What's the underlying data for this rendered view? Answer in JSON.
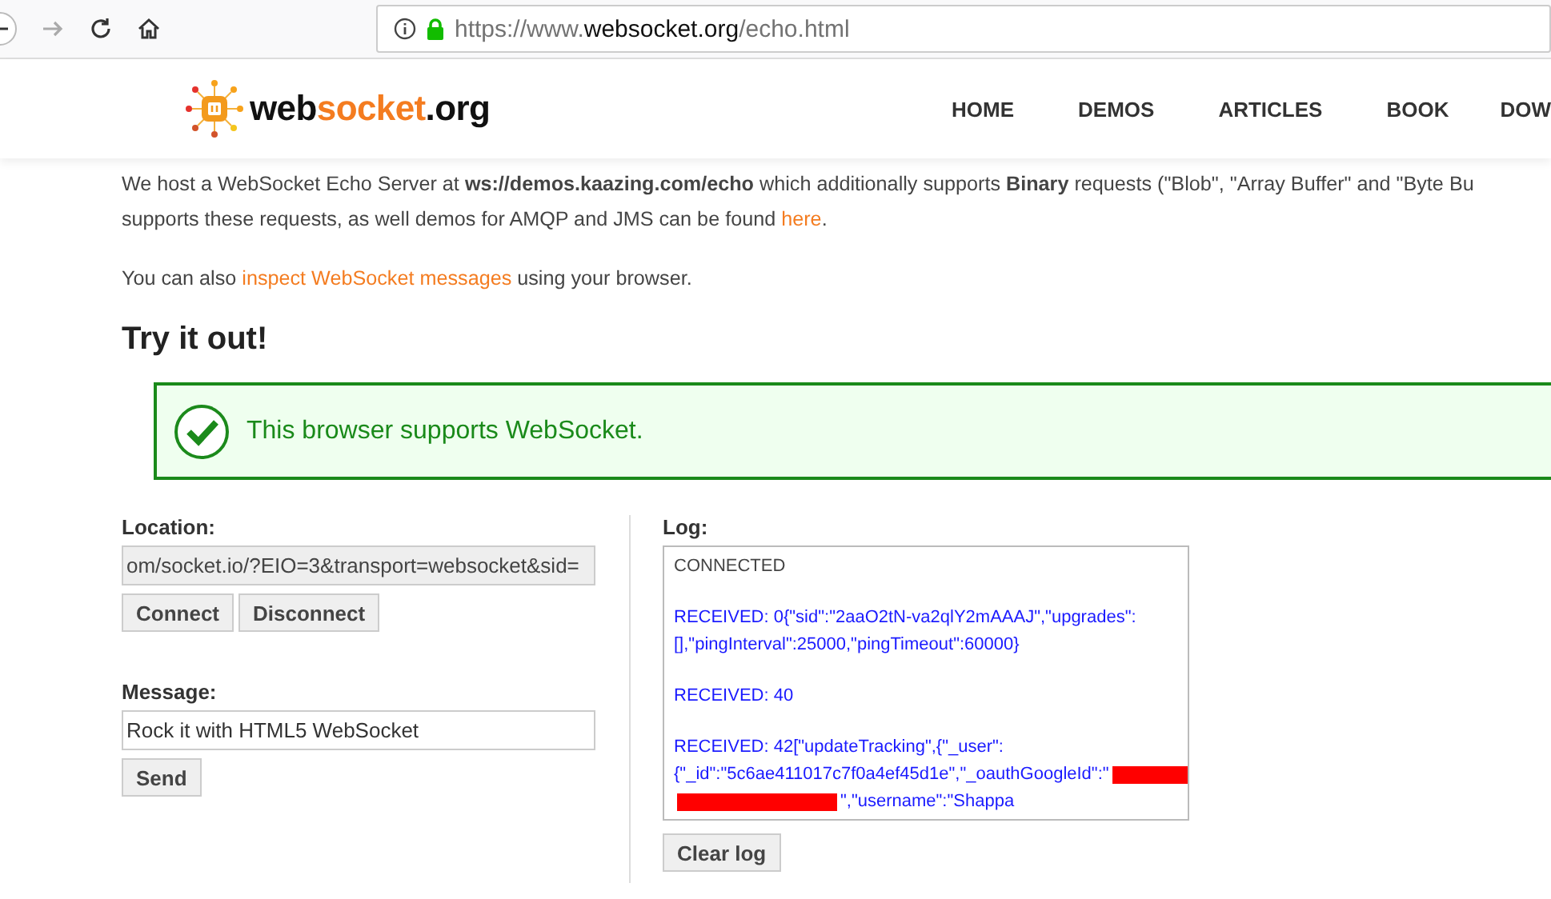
{
  "browser": {
    "url_prefix": "https://www.",
    "url_domain": "websocket.org",
    "url_path": "/echo.html"
  },
  "site": {
    "logo_left": "web",
    "logo_mid": "socket",
    "logo_right": ".org",
    "nav": [
      "HOME",
      "DEMOS",
      "ARTICLES",
      "BOOK",
      "DOW"
    ]
  },
  "intro": {
    "line_1": "We host a WebSocket Echo Server at **ws://demos.kaazing.com/echo** which additionally supports **Binary** requests (\"Blob\", \"Array Buffer\" and \"Byte Bu",
    "line_2": "supports these requests, as well demos for AMQP and JMS can be found",
    "line_2_link": "here",
    "line_2_end": "."
  },
  "inspect": {
    "before": "You can also",
    "link": "inspect WebSocket messages",
    "after": "using your browser."
  },
  "heading": "Try it out!",
  "support_notice": {
    "text": "This browser supports WebSocket.",
    "supported": true
  },
  "location": {
    "label": "Location:",
    "value": "om/socket.io/?EIO=3&transport=websocket&sid=",
    "disabled": true
  },
  "connection_buttons": [
    "Connect",
    "Disconnect"
  ],
  "message": {
    "label": "Message:",
    "value": "Rock it with HTML5 WebSocket"
  },
  "send_button": "Send",
  "log": {
    "label": "Log:",
    "clear_button": "Clear log",
    "entries": [
      {
        "kind": "status",
        "segments": [
          {
            "kind": "text",
            "text": "CONNECTED"
          }
        ]
      },
      {
        "kind": "received",
        "segments": [
          {
            "kind": "text",
            "text": "RECEIVED: 0{\"sid\":\"2aaO2tN-va2qlY2mAAAJ\",\"upgrades\": [],\"pingInterval\":25000,\"pingTimeout\":60000}"
          }
        ]
      },
      {
        "kind": "received",
        "segments": [
          {
            "kind": "text",
            "text": "RECEIVED: 40"
          }
        ]
      },
      {
        "kind": "received",
        "segments": [
          {
            "kind": "text",
            "text": "RECEIVED: 42[\"updateTracking\",{\"_user\": {\"_id\":\"5c6ae411017c7f0a4ef45d1e\",\"_oauthGoogleId\":\""
          },
          {
            "kind": "redaction"
          },
          {
            "kind": "redaction"
          },
          {
            "kind": "text",
            "text": "\",\"username\":\"Shappa"
          }
        ]
      }
    ]
  }
}
